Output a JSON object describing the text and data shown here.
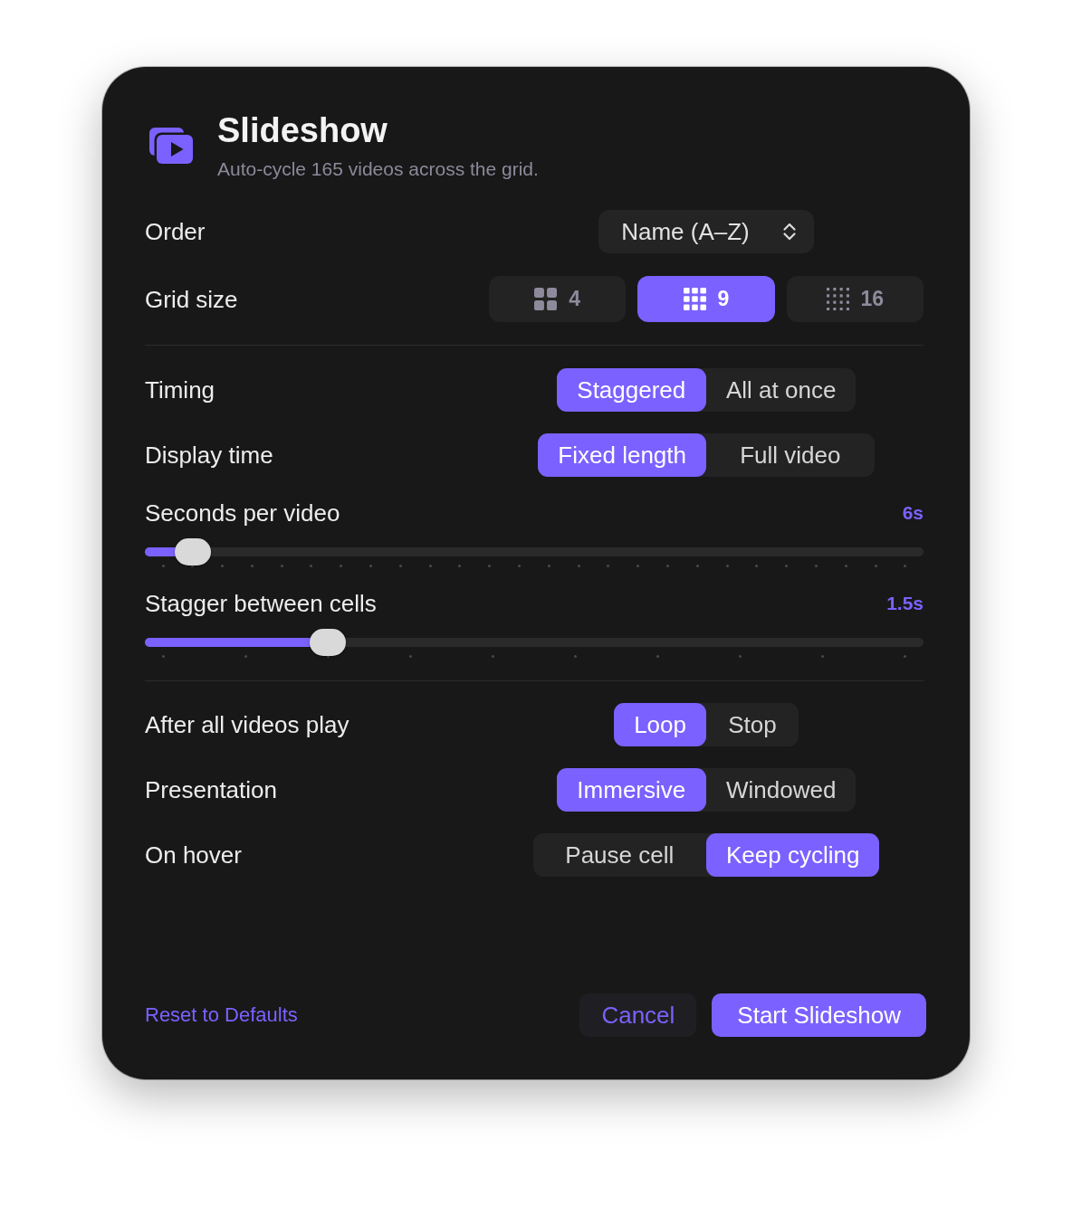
{
  "header": {
    "title": "Slideshow",
    "subtitle": "Auto-cycle 165 videos across the grid."
  },
  "order": {
    "label": "Order",
    "value": "Name (A–Z)"
  },
  "grid_size": {
    "label": "Grid size",
    "options": [
      {
        "label": "4",
        "kind": "coarse",
        "selected": false
      },
      {
        "label": "9",
        "kind": "medium",
        "selected": true
      },
      {
        "label": "16",
        "kind": "fine",
        "selected": false
      }
    ]
  },
  "playback": [
    {
      "label": "Timing",
      "options": [
        {
          "label": "Staggered",
          "selected": true
        },
        {
          "label": "All at once",
          "selected": false
        }
      ]
    },
    {
      "label": "Display time",
      "options": [
        {
          "label": "Fixed length",
          "selected": true
        },
        {
          "label": "Full video",
          "selected": false
        }
      ]
    }
  ],
  "sliders": [
    {
      "label": "Seconds per video",
      "reading": "6s",
      "level": 0.04,
      "kind": "fine"
    },
    {
      "label": "Stagger between cells",
      "reading": "1.5s",
      "level": 0.2222,
      "kind": "coarse"
    }
  ],
  "behavior": [
    {
      "label": "After all videos play",
      "options": [
        {
          "label": "Loop",
          "selected": true
        },
        {
          "label": "Stop",
          "selected": false
        }
      ]
    },
    {
      "label": "Presentation",
      "options": [
        {
          "label": "Immersive",
          "selected": true
        },
        {
          "label": "Windowed",
          "selected": false
        }
      ]
    },
    {
      "label": "On hover",
      "options": [
        {
          "label": "Pause cell",
          "selected": false
        },
        {
          "label": "Keep cycling",
          "selected": true
        }
      ]
    }
  ],
  "footer": {
    "reset_link": "Reset to Defaults",
    "buttons": [
      {
        "label": "Cancel",
        "kind": "secondary"
      },
      {
        "label": "Start Slideshow",
        "kind": "primary"
      }
    ]
  }
}
